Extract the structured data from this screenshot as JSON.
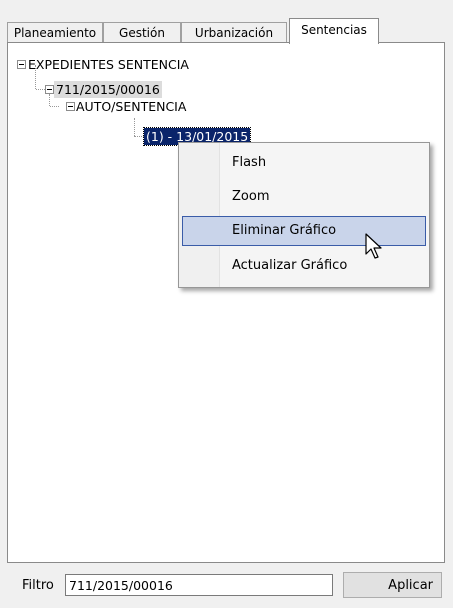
{
  "tabs": [
    {
      "label": "Planeamiento"
    },
    {
      "label": "Gestión"
    },
    {
      "label": "Urbanización"
    },
    {
      "label": "Sentencias"
    }
  ],
  "tree": {
    "root": "EXPEDIENTES SENTENCIA",
    "expediente": "711/2015/00016",
    "category": "AUTO/SENTENCIA",
    "document": "(1) - 13/01/2015"
  },
  "context_menu": {
    "items": [
      {
        "label": "Flash"
      },
      {
        "label": "Zoom"
      },
      {
        "label": "Eliminar Gráfico"
      },
      {
        "label": "Actualizar Gráfico"
      }
    ]
  },
  "filter": {
    "label": "Filtro",
    "value": "711/2015/00016",
    "apply_label": "Aplicar"
  }
}
